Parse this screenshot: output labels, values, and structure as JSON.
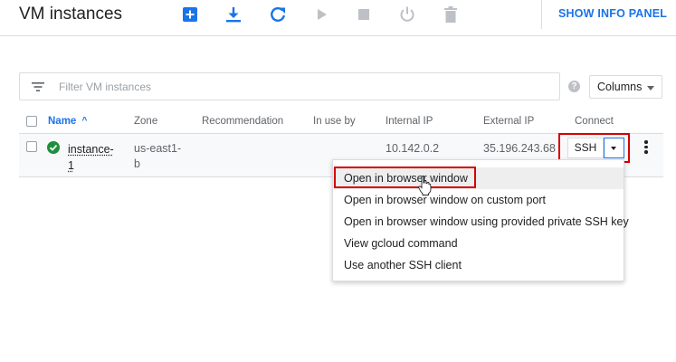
{
  "header": {
    "title": "VM instances",
    "toolbar": [
      {
        "name": "create-instance",
        "icon": "add-box-icon",
        "color": "#1a73e8"
      },
      {
        "name": "import-vm",
        "icon": "download-icon",
        "color": "#1a73e8"
      },
      {
        "name": "refresh",
        "icon": "refresh-icon",
        "color": "#1a73e8"
      },
      {
        "name": "start",
        "icon": "play-icon",
        "color": "#bdc1c6"
      },
      {
        "name": "stop",
        "icon": "stop-icon",
        "color": "#bdc1c6"
      },
      {
        "name": "reset",
        "icon": "power-icon",
        "color": "#bdc1c6"
      },
      {
        "name": "delete",
        "icon": "trash-icon",
        "color": "#bdc1c6"
      }
    ],
    "info_panel_label": "SHOW INFO PANEL"
  },
  "filter": {
    "placeholder": "Filter VM instances",
    "value": "",
    "columns_label": "Columns",
    "help_glyph": "?"
  },
  "table": {
    "headers": {
      "name": "Name",
      "sort_glyph": "^",
      "zone": "Zone",
      "recommendation": "Recommendation",
      "in_use_by": "In use by",
      "internal_ip": "Internal IP",
      "external_ip": "External IP",
      "connect": "Connect"
    },
    "rows": [
      {
        "name": "instance-1",
        "zone": "us-east1-b",
        "recommendation": "",
        "in_use_by": "",
        "internal_ip": "10.142.0.2",
        "external_ip": "35.196.243.68",
        "status": "running",
        "ssh_label": "SSH"
      }
    ]
  },
  "ssh_menu": {
    "items": [
      "Open in browser window",
      "Open in browser window on custom port",
      "Open in browser window using provided private SSH key",
      "View gcloud command",
      "Use another SSH client"
    ],
    "hovered_index": 0
  },
  "colors": {
    "accent": "#1a73e8",
    "status_running": "#1e8e3e",
    "highlight": "#d50000"
  }
}
